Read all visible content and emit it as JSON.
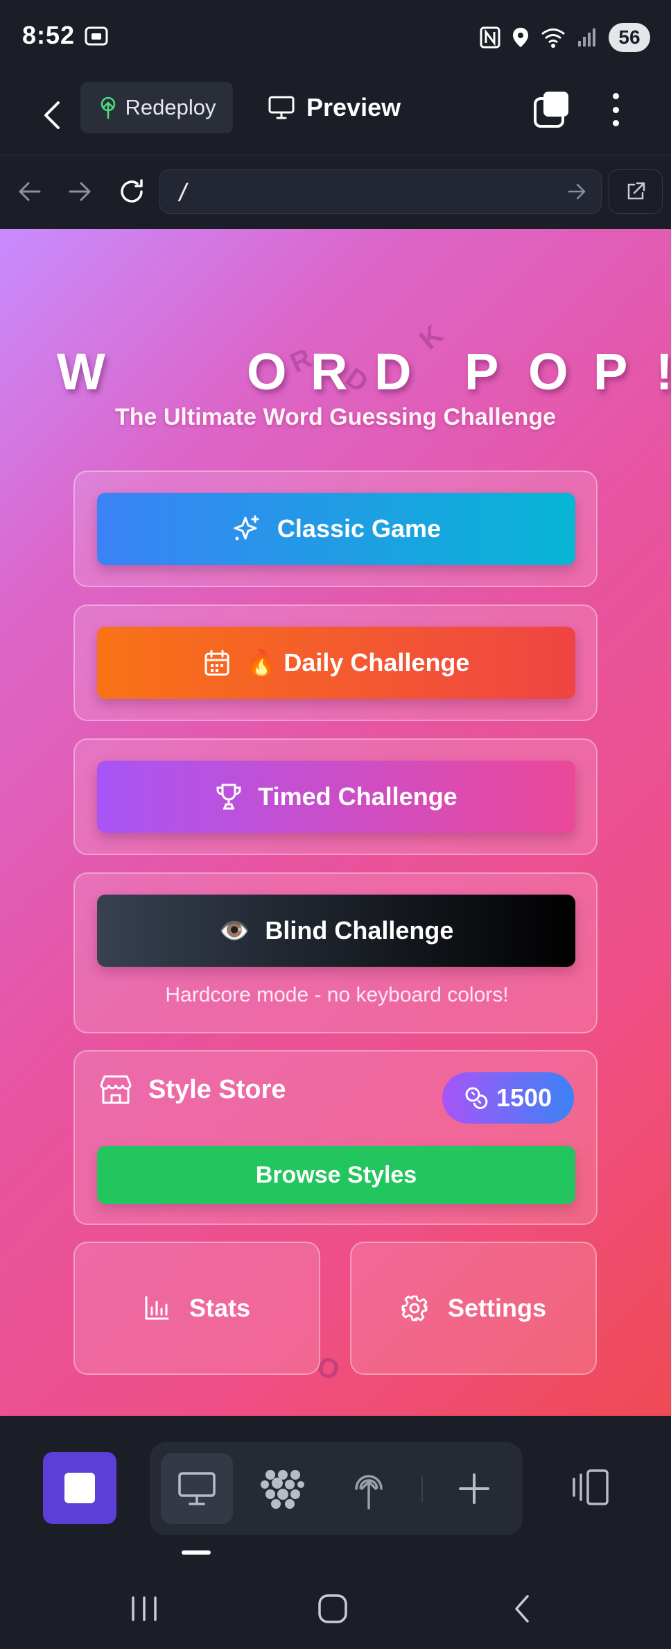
{
  "status_bar": {
    "time": "8:52",
    "battery": "56",
    "icons": [
      "screenshot-icon",
      "nfc-icon",
      "location-icon",
      "wifi-icon",
      "signal-icon",
      "battery-icon"
    ]
  },
  "app_bar": {
    "back_icon": "chevron-left-icon",
    "redeploy_label": "Redeploy",
    "preview_label": "Preview",
    "icons": [
      "redeploy-icon",
      "monitor-icon",
      "tabs-icon",
      "more-vertical-icon"
    ]
  },
  "browser": {
    "url": "/",
    "icons": [
      "arrow-left-icon",
      "arrow-right-icon",
      "reload-icon",
      "go-arrow-icon",
      "external-link-icon"
    ]
  },
  "game": {
    "title_letters": [
      "W",
      "O",
      "R",
      "D",
      "P",
      "O",
      "P",
      "!"
    ],
    "floating_letters": [
      "R",
      "D",
      "K",
      "O"
    ],
    "subtitle": "The Ultimate Word Guessing Challenge",
    "modes": {
      "classic": {
        "label": "Classic Game",
        "icon": "sparkles-icon"
      },
      "daily": {
        "label": "Daily Challenge",
        "emoji": "🔥",
        "icon": "calendar-icon"
      },
      "timed": {
        "label": "Timed Challenge",
        "icon": "trophy-icon"
      },
      "blind": {
        "label": "Blind Challenge",
        "emoji": "👁️",
        "description": "Hardcore mode - no keyboard colors!"
      }
    },
    "store": {
      "title": "Style Store",
      "coins": "1500",
      "browse_label": "Browse Styles",
      "icons": [
        "store-icon",
        "coins-icon"
      ]
    },
    "stats_label": "Stats",
    "settings_label": "Settings"
  },
  "bottom_bar": {
    "icons": [
      "stop-icon",
      "monitor-icon",
      "apps-grid-icon",
      "deploy-icon",
      "plus-icon",
      "device-frame-icon"
    ]
  },
  "system_nav": {
    "icons": [
      "recents-icon",
      "home-icon",
      "back-icon"
    ]
  },
  "colors": {
    "classic_gradient": [
      "#3b82f6",
      "#06b6d4"
    ],
    "daily_gradient": [
      "#f97316",
      "#ef4444"
    ],
    "timed_gradient": [
      "#a855f7",
      "#ec4899"
    ],
    "blind_gradient": [
      "#374151",
      "#000000"
    ],
    "browse_button": "#22c55e",
    "coins_gradient": [
      "#a855f7",
      "#3b82f6"
    ],
    "stop_button": "#5b3fd6"
  }
}
